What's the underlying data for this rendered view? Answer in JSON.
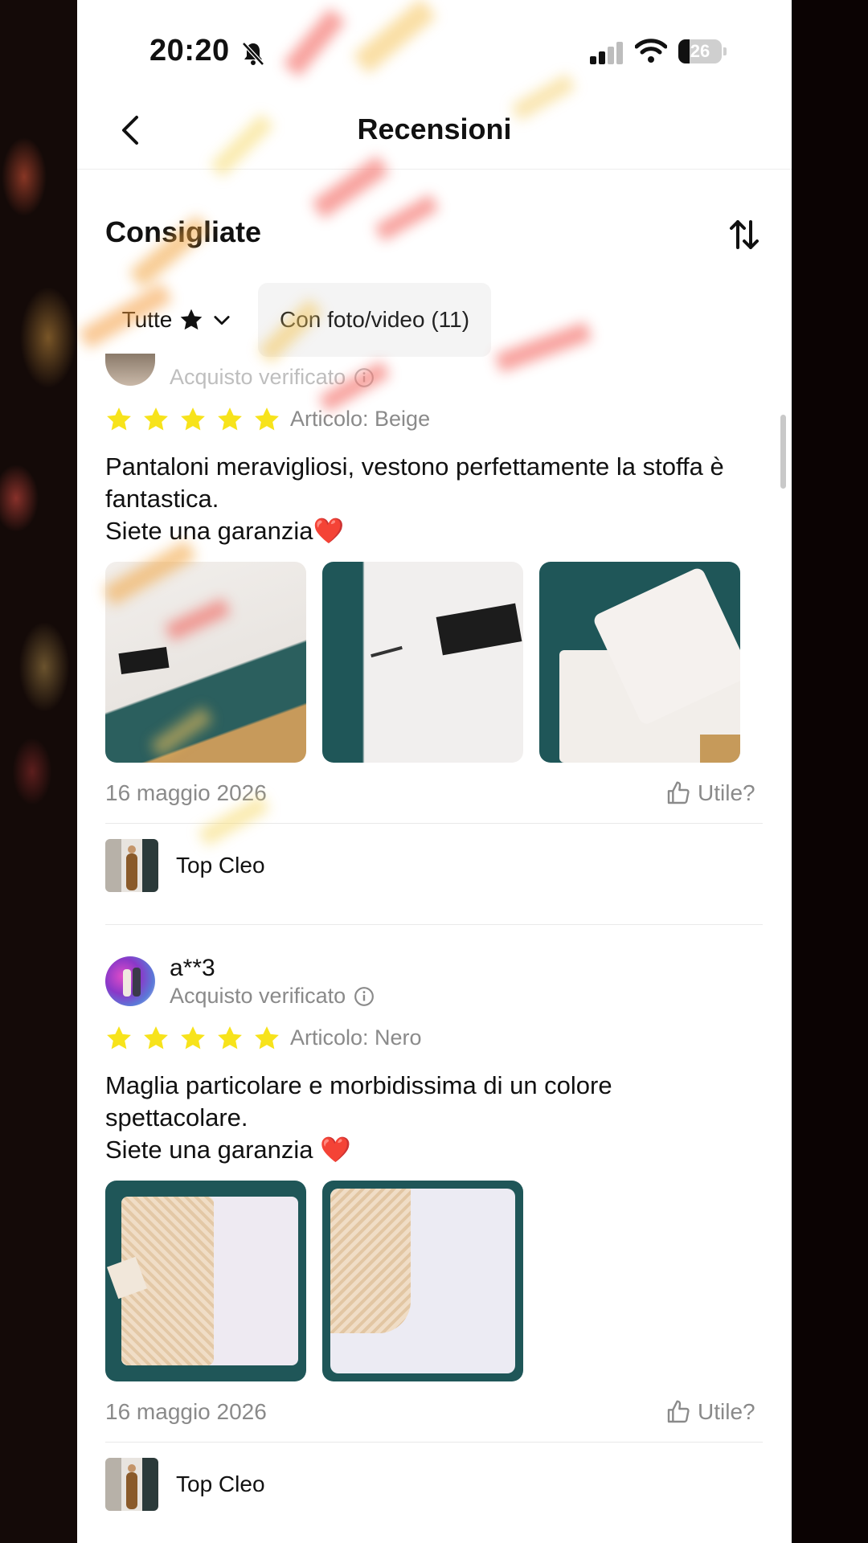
{
  "status_bar": {
    "time": "20:20",
    "battery": "26",
    "battery_level": 0.26
  },
  "nav": {
    "title": "Recensioni"
  },
  "section": {
    "title": "Consigliate"
  },
  "filters": {
    "all_label": "Tutte",
    "media_label": "Con foto/video (11)"
  },
  "reviews": [
    {
      "verified": "Acquisto verificato",
      "rating": 5,
      "variant": "Articolo: Beige",
      "text": "Pantaloni meravigliosi, vestono perfettamente la stoffa è fantastica.\nSiete una garanzia❤️",
      "date": "16 maggio 2026",
      "helpful": "Utile?",
      "product": "Top Cleo"
    },
    {
      "reviewer": "a**3",
      "verified": "Acquisto verificato",
      "rating": 5,
      "variant": "Articolo: Nero",
      "text": "Maglia particolare e morbidissima di un colore spettacolare.\nSiete una garanzia ❤️",
      "date": "16 maggio 2026",
      "helpful": "Utile?",
      "product": "Top Cleo"
    }
  ],
  "colors": {
    "star": "#f7e31b",
    "muted": "#8a8a8a",
    "photo_bg": "#1f5a5c"
  }
}
